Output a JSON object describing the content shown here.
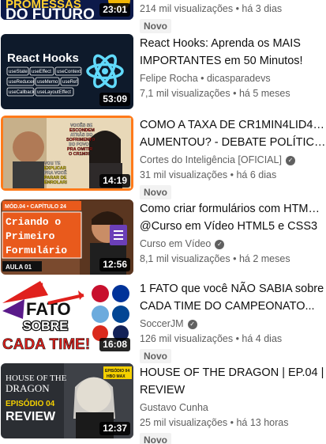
{
  "videos": [
    {
      "thumb_text": [
        "PROMESSAS",
        "DO FUTURO"
      ],
      "duration": "23:01",
      "title_lines": [],
      "channel": "",
      "verified": false,
      "meta": "214 mil visualizações • há 3 dias",
      "badge": "Novo"
    },
    {
      "thumb_text": [
        "React Hooks",
        "useState",
        "useEffect",
        "useContext",
        "useReducer",
        "useMemo",
        "useRef",
        "useCallback",
        "useLayoutEffect"
      ],
      "duration": "53:09",
      "title_lines": [
        "React Hooks: Aprenda os MAIS",
        "IMPORTANTES em 50 Minutos!"
      ],
      "channel": "Felipe Rocha • dicasparadevs",
      "verified": false,
      "meta": "7,1 mil visualizações • há 5 meses",
      "badge": ""
    },
    {
      "thumb_text": [
        "VOCÊS SE",
        "ESCONDEM",
        "ATRÁS DO",
        "SOFRIMENTO",
        "DO POVO",
        "PRA OMITIR",
        "O CR1M3!",
        "VOU TE",
        "EXPLICAR",
        "PRA VOCÊ",
        "PARAR DE",
        "ENROLAR!"
      ],
      "duration": "14:19",
      "title_lines": [
        "COMO A TAXA DE CR1MIN4LID4DE",
        "AUMENTOU? - DEBATE POLÍTICO:..."
      ],
      "channel": "Cortes do Inteligência [OFICIAL]",
      "verified": true,
      "meta": "31 mil visualizações • há 6 dias",
      "badge": "Novo"
    },
    {
      "thumb_text": [
        "MÓD.04 • CAPÍTULO 24",
        "Criando o",
        "Primeiro",
        "Formulário",
        "AULA 01"
      ],
      "duration": "12:56",
      "title_lines": [
        "Como criar formulários com HTML5 -",
        "@Curso em Vídeo HTML5 e CSS3"
      ],
      "channel": "Curso em Vídeo",
      "verified": true,
      "meta": "8,1 mil visualizações • há 2 meses",
      "badge": ""
    },
    {
      "thumb_text": [
        "1",
        "FATO",
        "SOBRE",
        "CADA TIME!"
      ],
      "duration": "16:08",
      "title_lines": [
        "1 FATO que você NÃO SABIA sobre",
        "CADA TIME DO CAMPEONATO..."
      ],
      "channel": "SoccerJM",
      "verified": true,
      "meta": "126 mil visualizações • há 4 dias",
      "badge": "Novo"
    },
    {
      "thumb_text": [
        "HOUSE OF THE",
        "DRAGON",
        "EPISÓDIO 04",
        "REVIEW",
        "EPISÓDIO 04",
        "HBO MAX"
      ],
      "duration": "12:37",
      "title_lines": [
        "HOUSE OF THE DRAGON | EP.04 |",
        "REVIEW"
      ],
      "channel": "Gustavo Cunha",
      "verified": false,
      "meta": "25 mil visualizações • há 13 horas",
      "badge": "Novo"
    }
  ],
  "icons": {
    "verified": "check-circle-icon"
  }
}
